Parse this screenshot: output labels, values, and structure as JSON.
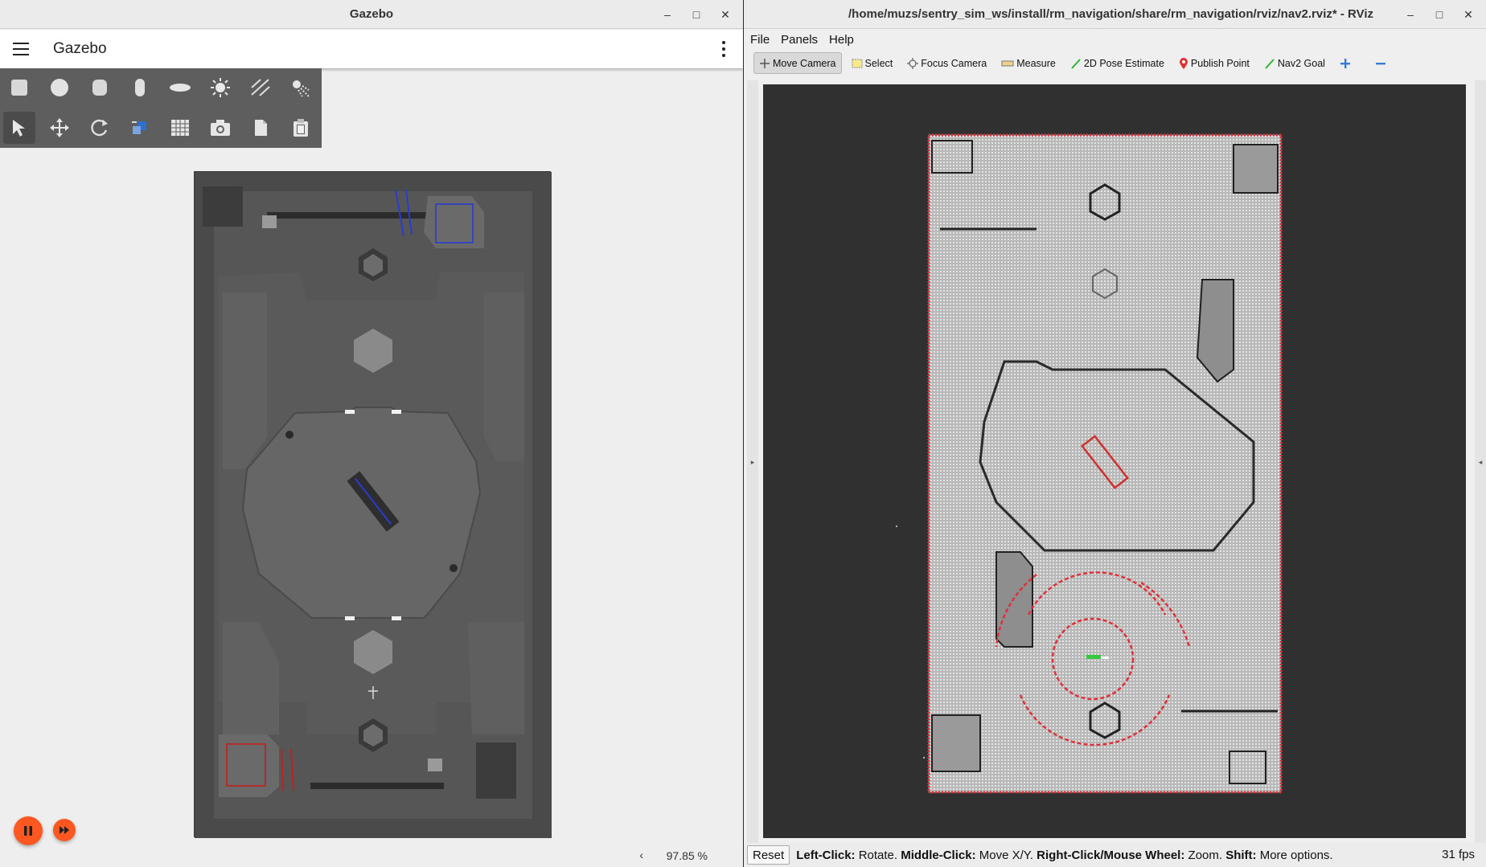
{
  "gazebo": {
    "window_title": "Gazebo",
    "app_title": "Gazebo",
    "shape_tools": [
      "box-icon",
      "sphere-icon",
      "cylinder-icon",
      "capsule-icon",
      "ellipsoid-icon",
      "sun-light-icon",
      "directional-light-icon",
      "spot-light-icon"
    ],
    "transform_tools": [
      "select-arrow-icon",
      "translate-icon",
      "rotate-icon",
      "snap-icon",
      "grid-icon",
      "camera-screenshot-icon",
      "copy-icon",
      "paste-icon"
    ],
    "rtf": "97.85 %",
    "rtf_chevron": "‹",
    "play_state": "paused"
  },
  "rviz": {
    "window_title": "/home/muzs/sentry_sim_ws/install/rm_navigation/share/rm_navigation/rviz/nav2.rviz* - RViz",
    "menu": [
      "File",
      "Panels",
      "Help"
    ],
    "tools": [
      {
        "label": "Move Camera",
        "icon": "move-camera-icon"
      },
      {
        "label": "Select",
        "icon": "select-icon"
      },
      {
        "label": "Focus Camera",
        "icon": "focus-camera-icon"
      },
      {
        "label": "Measure",
        "icon": "measure-icon"
      },
      {
        "label": "2D Pose Estimate",
        "icon": "pose-estimate-icon"
      },
      {
        "label": "Publish Point",
        "icon": "publish-point-icon"
      },
      {
        "label": "Nav2 Goal",
        "icon": "nav2-goal-icon"
      }
    ],
    "reset_label": "Reset",
    "hint": {
      "k1": "Left-Click:",
      "v1": " Rotate. ",
      "k2": "Middle-Click:",
      "v2": " Move X/Y. ",
      "k3": "Right-Click/Mouse Wheel:",
      "v3": " Zoom. ",
      "k4": "Shift:",
      "v4": " More options."
    },
    "fps": "31 fps",
    "colors": {
      "laser": "#e0303a",
      "map_free": "#c8c8c8",
      "map_bg": "#303030",
      "robot": "#36c93f"
    }
  }
}
